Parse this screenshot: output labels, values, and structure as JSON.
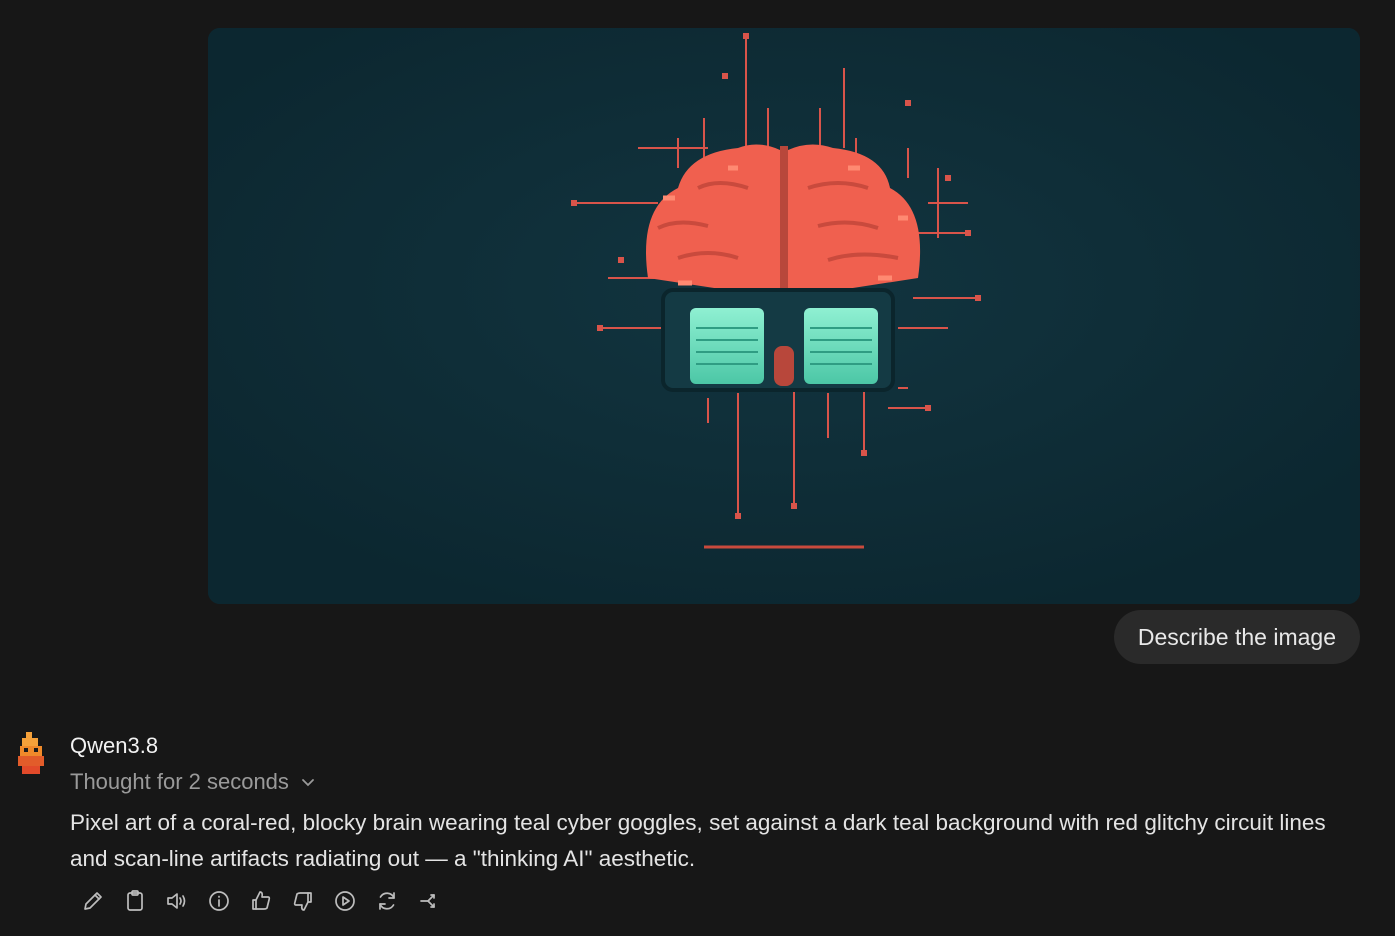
{
  "user_message": {
    "text": "Describe the image",
    "image": {
      "subject": "pixel-art coral-red brain with teal cyber goggles",
      "colors": {
        "background": "#0e2a33",
        "brain": "#f0604f",
        "goggles": "#6fe0c0",
        "circuit": "#e0524a"
      }
    }
  },
  "assistant": {
    "model_name": "Qwen3.8",
    "thought_label": "Thought for 2 seconds",
    "response": "Pixel art of a coral-red, blocky brain wearing teal cyber goggles, set against a dark teal background with red glitchy circuit lines and scan-line artifacts radiating out — a \"thinking AI\" aesthetic.",
    "actions": [
      {
        "name": "edit",
        "icon": "pencil-icon"
      },
      {
        "name": "copy",
        "icon": "clipboard-icon"
      },
      {
        "name": "read-aloud",
        "icon": "speaker-icon"
      },
      {
        "name": "info",
        "icon": "info-icon"
      },
      {
        "name": "good-response",
        "icon": "thumbs-up-icon"
      },
      {
        "name": "bad-response",
        "icon": "thumbs-down-icon"
      },
      {
        "name": "continue",
        "icon": "play-icon"
      },
      {
        "name": "regenerate",
        "icon": "refresh-icon"
      },
      {
        "name": "branch",
        "icon": "branch-icon"
      }
    ]
  },
  "colors": {
    "page_background": "#171717",
    "bubble_background": "#2a2a2a",
    "muted_text": "#9a9a9a"
  }
}
